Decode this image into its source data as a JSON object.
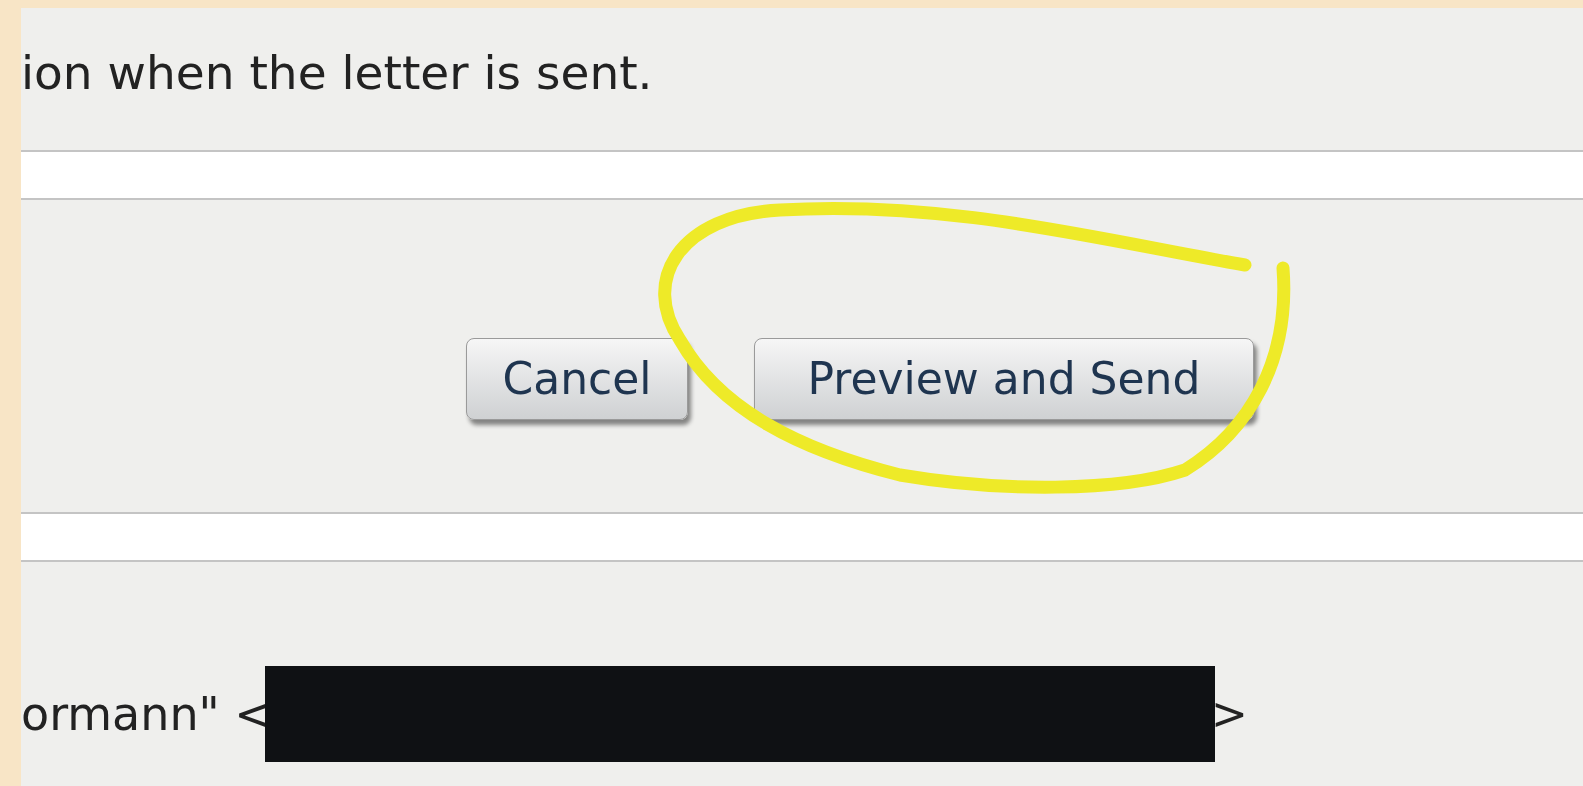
{
  "intro_text": "ion when the letter is sent.",
  "buttons": [
    {
      "label": "Cancel",
      "kind": "cancel"
    },
    {
      "label": "Preview and Send",
      "kind": "primary"
    }
  ],
  "recipient": {
    "name_fragment": "ormann\" <",
    "closing": ">",
    "redacted": true
  }
}
